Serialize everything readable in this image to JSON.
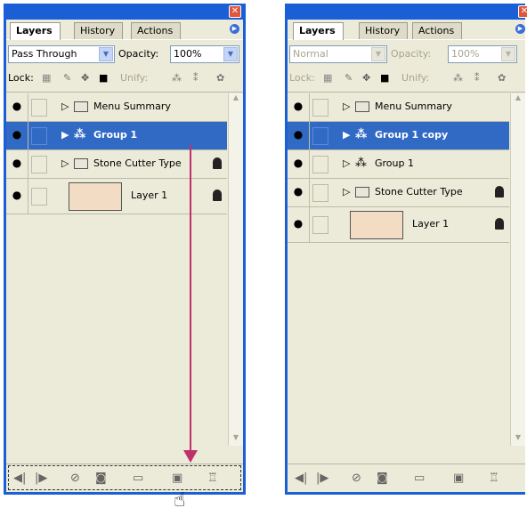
{
  "left": {
    "close": "✕",
    "tabs": [
      "Layers",
      "History",
      "Actions"
    ],
    "blend": "Pass Through",
    "opacity_label": "Opacity:",
    "opacity": "100%",
    "lock_label": "Lock:",
    "unify_label": "Unify:",
    "layers": [
      {
        "name": "Menu Summary",
        "kind": "folder",
        "selected": false
      },
      {
        "name": "Group 1",
        "kind": "group",
        "selected": true
      },
      {
        "name": "Stone Cutter Type",
        "kind": "folder",
        "selected": false,
        "locked": true
      },
      {
        "name": "Layer 1",
        "kind": "image",
        "selected": false,
        "locked": true
      }
    ]
  },
  "right": {
    "close": "✕",
    "tabs": [
      "Layers",
      "History",
      "Actions"
    ],
    "blend": "Normal",
    "opacity_label": "Opacity:",
    "opacity": "100%",
    "lock_label": "Lock:",
    "unify_label": "Unify:",
    "layers": [
      {
        "name": "Menu Summary",
        "kind": "folder",
        "selected": false
      },
      {
        "name": "Group 1 copy",
        "kind": "group",
        "selected": true
      },
      {
        "name": "Group 1",
        "kind": "group",
        "selected": false
      },
      {
        "name": "Stone Cutter Type",
        "kind": "folder",
        "selected": false,
        "locked": true
      },
      {
        "name": "Layer 1",
        "kind": "image",
        "selected": false,
        "locked": true
      }
    ]
  },
  "colors": {
    "title_bar": "#1b5fd6",
    "selection": "#316ac5",
    "drag_arrow": "#c0306a"
  }
}
